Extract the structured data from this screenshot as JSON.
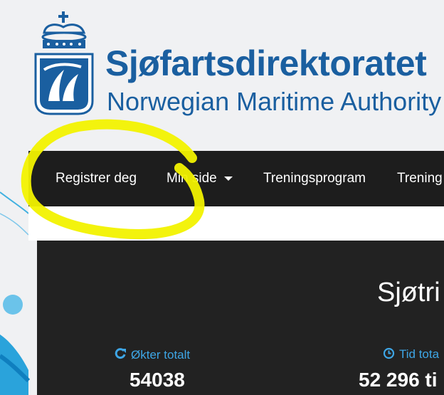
{
  "brand": {
    "name": "Sjøfartsdirektoratet",
    "subtitle": "Norwegian Maritime Authority"
  },
  "nav": {
    "items": [
      {
        "label": "Registrer deg"
      },
      {
        "label": "Min side",
        "dropdown": true
      },
      {
        "label": "Treningsprogram"
      },
      {
        "label": "Trening"
      }
    ]
  },
  "stats": {
    "title": "Sjøtri",
    "sessions": {
      "label": "Økter totalt",
      "value": "54038",
      "icon": "refresh-icon"
    },
    "time": {
      "label": "Tid tota",
      "value": "52 296 ti",
      "icon": "clock-icon"
    }
  },
  "colors": {
    "brand_blue": "#1a5fa0",
    "accent_blue": "#3ea6e6",
    "navbar_bg": "#1d1d1d",
    "panel_bg": "#222222",
    "highlight": "#f2f200"
  }
}
